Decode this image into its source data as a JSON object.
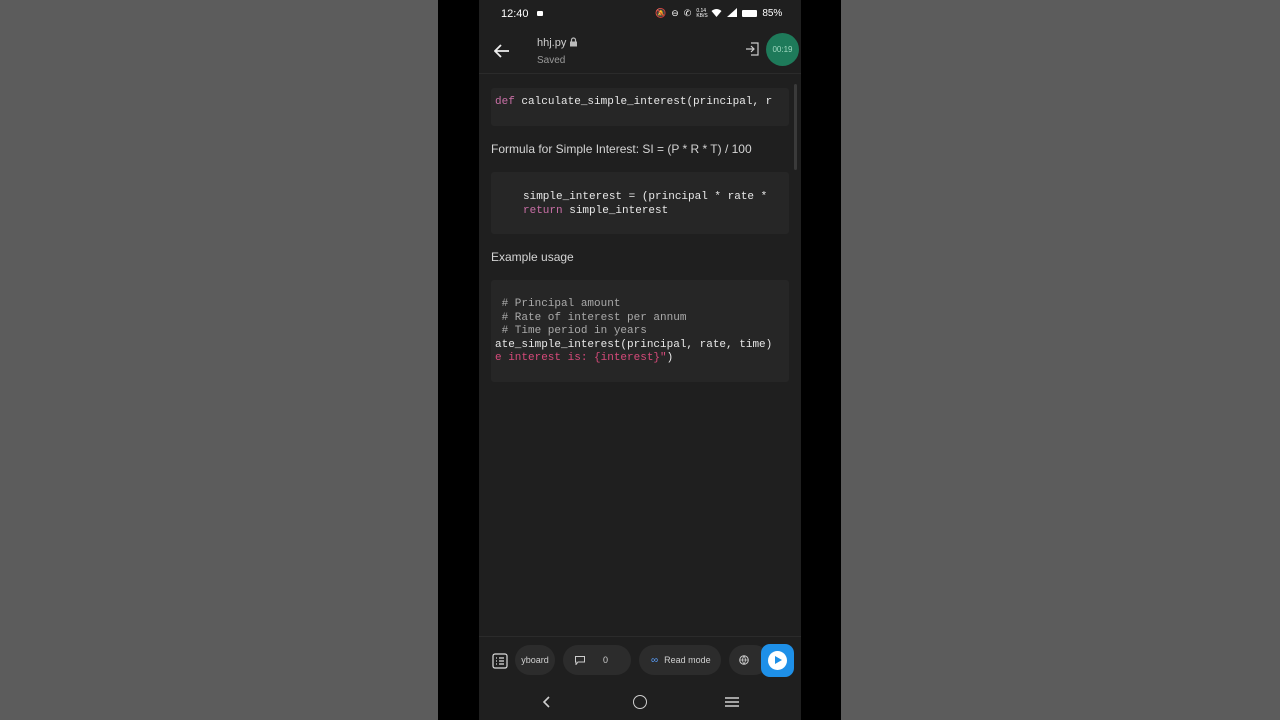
{
  "status_bar": {
    "time": "12:40",
    "icons": [
      "mute-icon",
      "dnd-icon",
      "call-icon",
      "data-speed-icon",
      "wifi-icon",
      "signal-icon",
      "battery-icon"
    ],
    "data_speed": "0.14 KB/S",
    "battery": "85%"
  },
  "app_bar": {
    "filename": "hhj.py",
    "status": "Saved",
    "timer": "00:19"
  },
  "content": {
    "code1": "calculate_simple_interest(principal, r",
    "code1_kw": "def",
    "para1": "Formula for Simple Interest: SI = (P * R * T) / 100",
    "code2_line1": "simple_interest = (principal * rate *",
    "code2_kw": "return",
    "code2_line2": "simple_interest",
    "para2": "Example usage",
    "code3_c1": " # Principal amount",
    "code3_c2": " # Rate of interest per annum",
    "code3_c3": " # Time period in years",
    "code3_l4": "ate_simple_interest(principal, rate, time)",
    "code3_l5_str": "e interest is: {interest}\"",
    "code3_l5_end": ")"
  },
  "toolbar": {
    "keyboard_label": "yboard",
    "comments_count": "0",
    "read_mode_label": "Read mode"
  },
  "colors": {
    "accent": "#1e90e8",
    "keyword": "#c96fa6",
    "string": "#d64a7a",
    "timer": "#1e7a5a"
  }
}
